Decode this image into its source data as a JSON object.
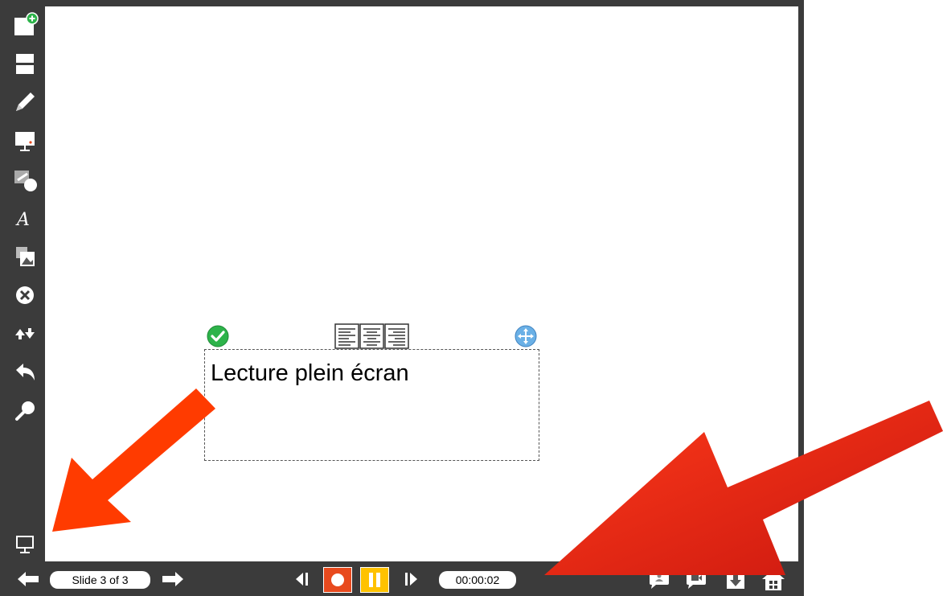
{
  "sidebar": {
    "tools": [
      {
        "icon": "add-slide-icon"
      },
      {
        "icon": "layout-icon"
      },
      {
        "icon": "pencil-icon"
      },
      {
        "icon": "presentation-board-icon"
      },
      {
        "icon": "shapes-icon"
      },
      {
        "icon": "text-font-icon"
      },
      {
        "icon": "insert-media-icon"
      },
      {
        "icon": "delete-icon"
      },
      {
        "icon": "reorder-icon"
      },
      {
        "icon": "undo-icon"
      },
      {
        "icon": "magnifier-icon"
      }
    ],
    "fullscreen_icon": "fullscreen-play-icon"
  },
  "canvas": {
    "textbox": {
      "text": "Lecture plein écran",
      "confirm_icon": "check-circle-icon",
      "align_icon": "text-align-icon",
      "move_icon": "move-handle-icon"
    }
  },
  "bottombar": {
    "slide_indicator": "Slide 3 of 3",
    "timer": "00:00:02",
    "prev_icon": "arrow-left-icon",
    "next_icon": "arrow-right-icon",
    "skip_back_icon": "skip-back-icon",
    "record_icon": "record-icon",
    "pause_icon": "pause-icon",
    "skip_forward_icon": "skip-forward-icon",
    "right_icons": [
      "comment-user-icon",
      "comment-video-icon",
      "download-icon",
      "home-icon"
    ]
  },
  "colors": {
    "chrome": "#3b3b3b",
    "record": "#e84a1e",
    "pause": "#ffc200",
    "confirm": "#2db34a",
    "annotation_arrow": "#ff3b00"
  }
}
